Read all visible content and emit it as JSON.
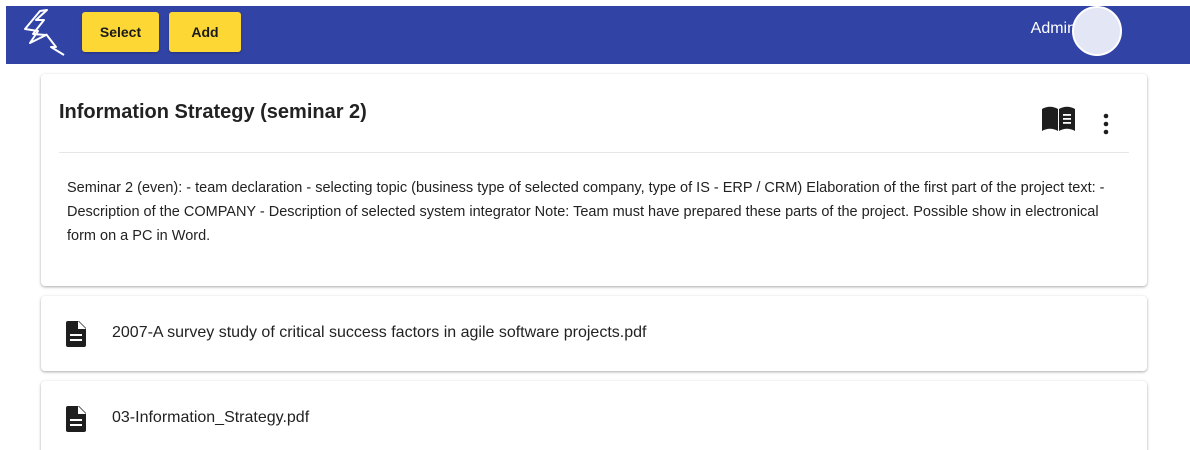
{
  "toolbar": {
    "select_label": "Select",
    "add_label": "Add",
    "user_name": "Admin",
    "logo_icon": "lightning-bolt-icon"
  },
  "colors": {
    "topbar": "#3143a4",
    "button": "#fdd835",
    "avatar": "#e3e6f5"
  },
  "course": {
    "title": "Information Strategy (seminar 2)",
    "description": "Seminar 2 (even): - team declaration - selecting topic (business type of selected company, type of IS - ERP / CRM) Elaboration of the first part of the project text: - Description of the COMPANY - Description of selected system integrator Note: Team must have prepared these parts of the project. Possible show in electronical form on a PC in Word.",
    "icons": [
      "book-open-icon",
      "more-vert-icon"
    ]
  },
  "files": [
    {
      "name": "2007-A survey study of critical success factors in agile software projects.pdf",
      "icon": "file-document-icon"
    },
    {
      "name": "03-Information_Strategy.pdf",
      "icon": "file-document-icon"
    }
  ]
}
